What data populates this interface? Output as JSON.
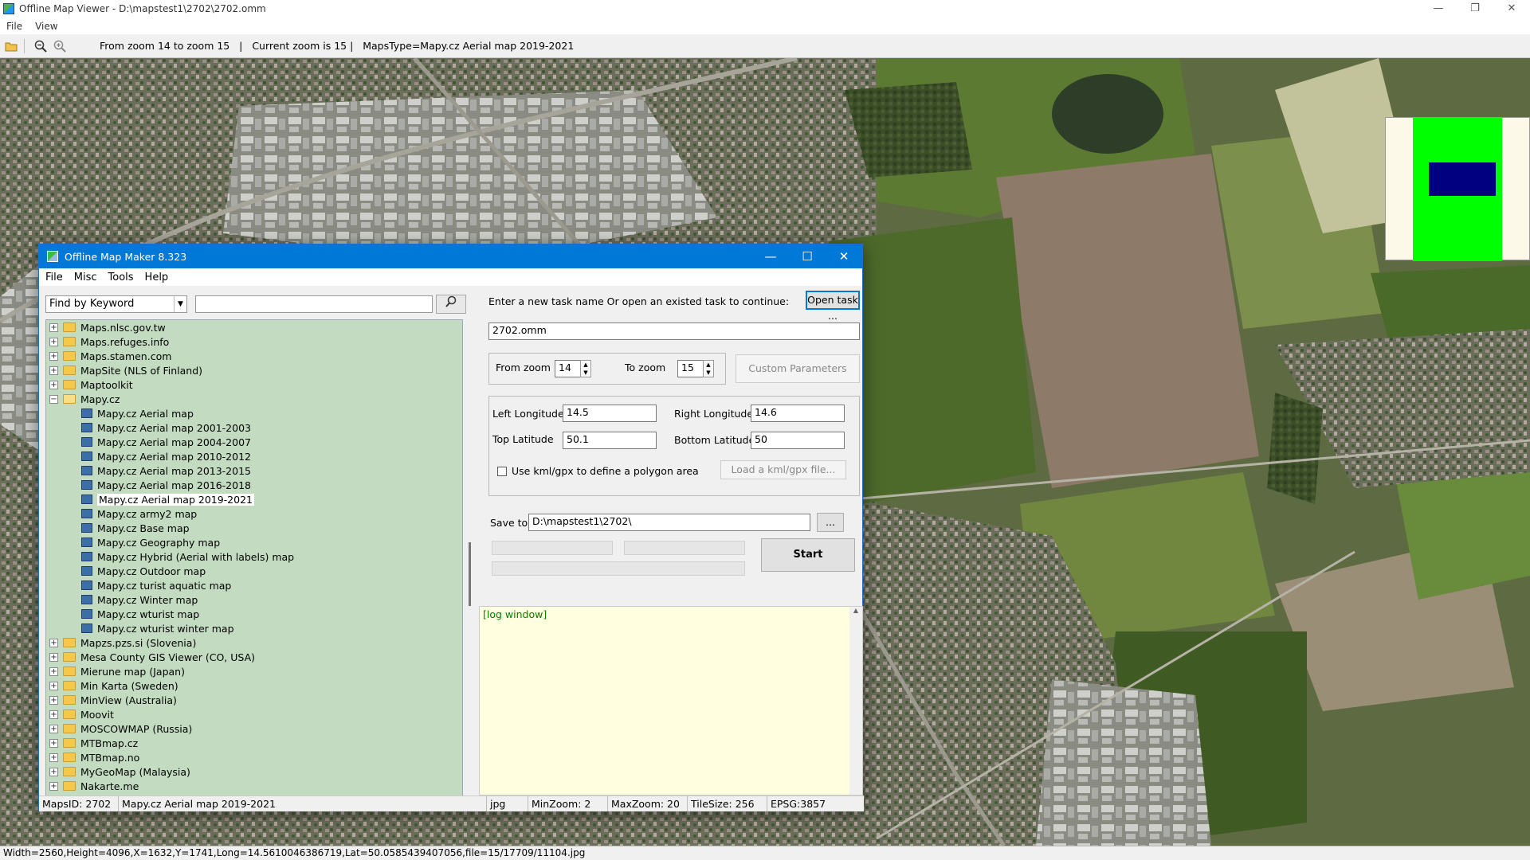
{
  "window": {
    "title": "Offline Map Viewer - D:\\mapstest1\\2702\\2702.omm",
    "minimize": "—",
    "restore": "❐",
    "close": "✕"
  },
  "menu": [
    "File",
    "View"
  ],
  "toolbar": {
    "info": "From zoom 14 to zoom 15   |   Current zoom is 15 |   MapsType=Mapy.cz Aerial map 2019-2021"
  },
  "statusbar": {
    "text": "Width=2560,Height=4096,X=1632,Y=1741,Long=14.5610046386719,Lat=50.0585439407056,file=15/17709/11104.jpg"
  },
  "minimap": {
    "view_color": "#000080",
    "bg_color": "#00ff00"
  },
  "dialog": {
    "title": "Offline Map Maker 8.323",
    "menu": [
      "File",
      "Misc",
      "Tools",
      "Help"
    ],
    "find_mode": "Find by Keyword",
    "find_value": "",
    "tree": [
      {
        "label": "Maps.nlsc.gov.tw",
        "type": "folder"
      },
      {
        "label": "Maps.refuges.info",
        "type": "folder"
      },
      {
        "label": "Maps.stamen.com",
        "type": "folder"
      },
      {
        "label": "MapSite (NLS of Finland)",
        "type": "folder"
      },
      {
        "label": "Maptoolkit",
        "type": "folder"
      },
      {
        "label": "Mapy.cz",
        "type": "folder-open"
      },
      {
        "label": "Mapy.cz Aerial map",
        "type": "leaf"
      },
      {
        "label": "Mapy.cz Aerial map 2001-2003",
        "type": "leaf"
      },
      {
        "label": "Mapy.cz Aerial map 2004-2007",
        "type": "leaf"
      },
      {
        "label": "Mapy.cz Aerial map 2010-2012",
        "type": "leaf"
      },
      {
        "label": "Mapy.cz Aerial map 2013-2015",
        "type": "leaf"
      },
      {
        "label": "Mapy.cz Aerial map 2016-2018",
        "type": "leaf"
      },
      {
        "label": "Mapy.cz Aerial map 2019-2021",
        "type": "leaf",
        "selected": true
      },
      {
        "label": "Mapy.cz army2 map",
        "type": "leaf"
      },
      {
        "label": "Mapy.cz Base map",
        "type": "leaf"
      },
      {
        "label": "Mapy.cz Geography map",
        "type": "leaf"
      },
      {
        "label": "Mapy.cz Hybrid (Aerial with labels) map",
        "type": "leaf"
      },
      {
        "label": "Mapy.cz Outdoor map",
        "type": "leaf"
      },
      {
        "label": "Mapy.cz turist aquatic map",
        "type": "leaf"
      },
      {
        "label": "Mapy.cz Winter map",
        "type": "leaf"
      },
      {
        "label": "Mapy.cz wturist map",
        "type": "leaf"
      },
      {
        "label": "Mapy.cz wturist winter map",
        "type": "leaf"
      },
      {
        "label": "Mapzs.pzs.si (Slovenia)",
        "type": "folder"
      },
      {
        "label": "Mesa County GIS Viewer (CO, USA)",
        "type": "folder"
      },
      {
        "label": "Mierune map (Japan)",
        "type": "folder"
      },
      {
        "label": "Min Karta (Sweden)",
        "type": "folder"
      },
      {
        "label": "MinView (Australia)",
        "type": "folder"
      },
      {
        "label": "Moovit",
        "type": "folder"
      },
      {
        "label": "MOSCOWMAP (Russia)",
        "type": "folder"
      },
      {
        "label": "MTBmap.cz",
        "type": "folder"
      },
      {
        "label": "MTBmap.no",
        "type": "folder"
      },
      {
        "label": "MyGeoMap (Malaysia)",
        "type": "folder"
      },
      {
        "label": "Nakarte.me",
        "type": "folder"
      }
    ],
    "task_prompt": "Enter a new task name Or open an existed task to continue:",
    "open_task": "Open task ...",
    "task_name": "2702.omm",
    "from_zoom_label": "From zoom",
    "from_zoom": "14",
    "to_zoom_label": "To zoom",
    "to_zoom": "15",
    "custom_params": "Custom Parameters",
    "left_lon_label": "Left Longitude",
    "left_lon": "14.5",
    "right_lon_label": "Right Longitude",
    "right_lon": "14.6",
    "top_lat_label": "Top Latitude",
    "top_lat": "50.1",
    "bottom_lat_label": "Bottom Latitude",
    "bottom_lat": "50",
    "use_kml_label": "Use kml/gpx to define a polygon area",
    "load_kml": "Load a kml/gpx file...",
    "save_to_label": "Save to:",
    "save_to": "D:\\mapstest1\\2702\\",
    "browse": "...",
    "start": "Start",
    "log": "[log window]",
    "status": {
      "maps_id": "MapsID: 2702",
      "maps_name": "Mapy.cz Aerial map 2019-2021",
      "format": "jpg",
      "min_zoom": "MinZoom: 2",
      "max_zoom": "MaxZoom: 20",
      "tile_size": "TileSize: 256",
      "epsg": "EPSG:3857"
    }
  }
}
